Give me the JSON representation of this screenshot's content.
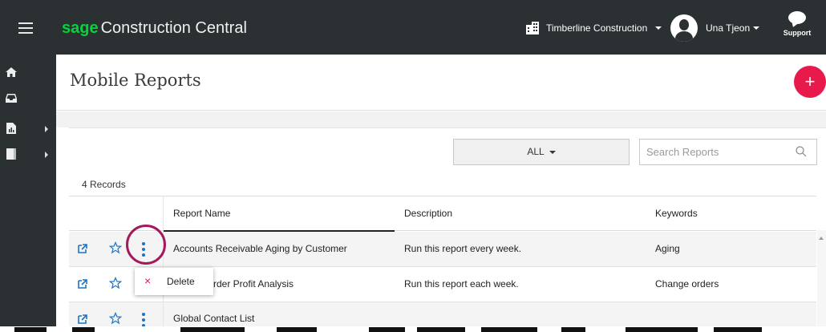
{
  "app": {
    "logo_brand": "sage",
    "logo_product": "Construction Central",
    "company": "Timberline Construction",
    "user_name": "Una Tjeon",
    "support_label": "Support"
  },
  "page": {
    "title": "Mobile Reports",
    "add_button": "+"
  },
  "toolbar": {
    "filter_label": "ALL",
    "search_placeholder": "Search Reports",
    "records_count": "4 Records"
  },
  "table": {
    "columns": [
      "Report Name",
      "Description",
      "Keywords"
    ],
    "rows": [
      {
        "name": "Accounts Receivable Aging by Customer",
        "description": "Run this report every week.",
        "keywords": "Aging"
      },
      {
        "name": "rder Profit Analysis",
        "description": "Run this report each week.",
        "keywords": "Change orders"
      },
      {
        "name": "Global Contact List",
        "description": "",
        "keywords": ""
      }
    ]
  },
  "context_menu": {
    "delete_icon": "×",
    "delete_label": "Delete"
  },
  "colors": {
    "topbar": "#2b3033",
    "brand_green": "#00d639",
    "accent_red": "#e8194b",
    "highlight_ring": "#a3195b",
    "link_blue": "#1a73c9"
  }
}
